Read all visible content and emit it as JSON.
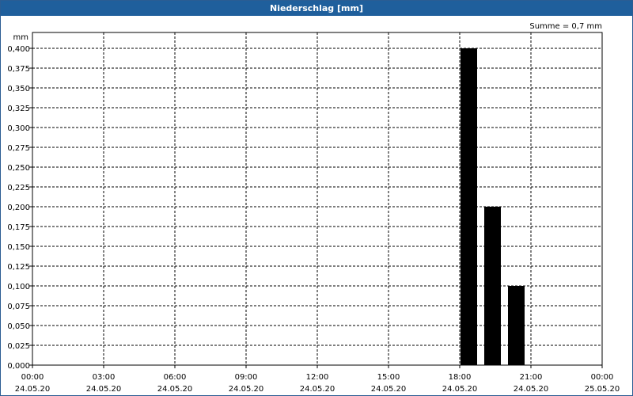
{
  "window": {
    "title": "Niederschlag [mm]"
  },
  "chart_data": {
    "type": "bar",
    "title": "Niederschlag [mm]",
    "ylabel": "mm",
    "annotation": "Summe = 0,7 mm",
    "ylim": [
      0,
      0.4
    ],
    "yticks": [
      "0,000",
      "0,025",
      "0,050",
      "0,075",
      "0,100",
      "0,125",
      "0,150",
      "0,175",
      "0,200",
      "0,225",
      "0,250",
      "0,275",
      "0,300",
      "0,325",
      "0,350",
      "0,375",
      "0,400"
    ],
    "xticks": [
      {
        "time": "00:00",
        "date": "24.05.20"
      },
      {
        "time": "03:00",
        "date": "24.05.20"
      },
      {
        "time": "06:00",
        "date": "24.05.20"
      },
      {
        "time": "09:00",
        "date": "24.05.20"
      },
      {
        "time": "12:00",
        "date": "24.05.20"
      },
      {
        "time": "15:00",
        "date": "24.05.20"
      },
      {
        "time": "18:00",
        "date": "24.05.20"
      },
      {
        "time": "21:00",
        "date": "24.05.20"
      },
      {
        "time": "00:00",
        "date": "25.05.20"
      }
    ],
    "xlim": [
      "24.05.20 00:00",
      "25.05.20 00:00"
    ],
    "grid": true,
    "bars": [
      {
        "start": "24.05.20 18:00",
        "end": "24.05.20 19:00",
        "value": 0.4
      },
      {
        "start": "24.05.20 19:00",
        "end": "24.05.20 20:00",
        "value": 0.2
      },
      {
        "start": "24.05.20 20:00",
        "end": "24.05.20 21:00",
        "value": 0.1
      }
    ],
    "colors": {
      "title_bar": "#1f5f9c",
      "bar": "#000000",
      "grid": "#000000"
    }
  }
}
